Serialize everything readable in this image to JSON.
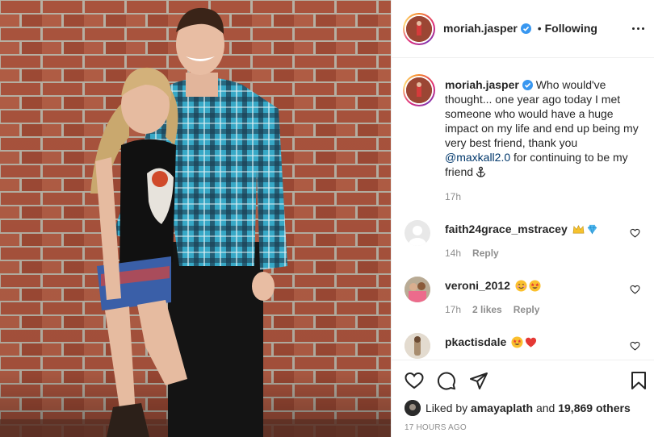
{
  "post": {
    "username": "moriah.jasper",
    "follow_status": "Following",
    "separator": "•"
  },
  "caption": {
    "username": "moriah.jasper",
    "text_before": "Who would've thought... one year ago today I met someone who would have a huge impact on my life and end up being my very best friend, thank you",
    "mention": "@maxkall2.0",
    "text_after": "for continuing to be my friend",
    "emoji": "anchor-icon",
    "time": "17h"
  },
  "comments": [
    {
      "username": "faith24grace_mstracey",
      "emojis": [
        "crown-icon",
        "gem-icon"
      ],
      "time": "14h",
      "likes": "",
      "reply": "Reply"
    },
    {
      "username": "veroni_2012",
      "emojis": [
        "smiling-face-icon",
        "star-struck-icon"
      ],
      "time": "17h",
      "likes": "2 likes",
      "reply": "Reply"
    },
    {
      "username": "pkactisdale",
      "emojis": [
        "star-struck-icon",
        "red-heart-icon"
      ],
      "time": "",
      "likes": "",
      "reply": ""
    }
  ],
  "likes": {
    "prefix": "Liked by",
    "user": "amayaplath",
    "middle": "and",
    "others": "19,869 others"
  },
  "timestamp": "17 HOURS AGO",
  "colors": {
    "verified": "#3897f0",
    "mention": "#00376b",
    "muted": "#8e8e8e",
    "heart": "#ed4956"
  }
}
